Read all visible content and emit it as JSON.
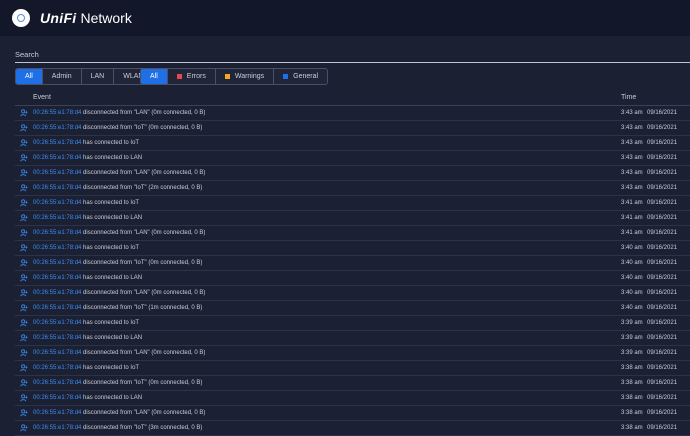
{
  "brand": {
    "name_part1": "UniFi",
    "name_part2": "Network"
  },
  "search": {
    "placeholder": "Search"
  },
  "filters_admin": [
    {
      "label": "All",
      "active": true
    },
    {
      "label": "Admin",
      "active": false
    },
    {
      "label": "LAN",
      "active": false
    },
    {
      "label": "WLAN",
      "active": false
    }
  ],
  "filters_level": [
    {
      "label": "All",
      "active": true,
      "color": ""
    },
    {
      "label": "Errors",
      "active": false,
      "color": "#e5484d"
    },
    {
      "label": "Warnings",
      "active": false,
      "color": "#f5a623"
    },
    {
      "label": "General",
      "active": false,
      "color": "#1f6fe6"
    }
  ],
  "table": {
    "col_event": "Event",
    "col_time": "Time",
    "rows": [
      {
        "mac": "00:26:55:e1:78:d4",
        "text": " disconnected from \"LAN\" (0m connected, 0 B)",
        "time": "3:43 am",
        "date": "09/16/2021"
      },
      {
        "mac": "00:26:55:e1:78:d4",
        "text": " disconnected from \"IoT\" (0m connected, 0 B)",
        "time": "3:43 am",
        "date": "09/16/2021"
      },
      {
        "mac": "00:26:55:e1:78:d4",
        "text": " has connected to IoT",
        "time": "3:43 am",
        "date": "09/16/2021"
      },
      {
        "mac": "00:26:55:e1:78:d4",
        "text": " has connected to LAN",
        "time": "3:43 am",
        "date": "09/16/2021"
      },
      {
        "mac": "00:26:55:e1:78:d4",
        "text": " disconnected from \"LAN\" (0m connected, 0 B)",
        "time": "3:43 am",
        "date": "09/16/2021"
      },
      {
        "mac": "00:26:55:e1:78:d4",
        "text": " disconnected from \"IoT\" (2m connected, 0 B)",
        "time": "3:43 am",
        "date": "09/16/2021"
      },
      {
        "mac": "00:26:55:e1:78:d4",
        "text": " has connected to IoT",
        "time": "3:41 am",
        "date": "09/16/2021"
      },
      {
        "mac": "00:26:55:e1:78:d4",
        "text": " has connected to LAN",
        "time": "3:41 am",
        "date": "09/16/2021"
      },
      {
        "mac": "00:26:55:e1:78:d4",
        "text": " disconnected from \"LAN\" (0m connected, 0 B)",
        "time": "3:41 am",
        "date": "09/16/2021"
      },
      {
        "mac": "00:26:55:e1:78:d4",
        "text": " has connected to IoT",
        "time": "3:40 am",
        "date": "09/16/2021"
      },
      {
        "mac": "00:26:55:e1:78:d4",
        "text": " disconnected from \"IoT\" (0m connected, 0 B)",
        "time": "3:40 am",
        "date": "09/16/2021"
      },
      {
        "mac": "00:26:55:e1:78:d4",
        "text": " has connected to LAN",
        "time": "3:40 am",
        "date": "09/16/2021"
      },
      {
        "mac": "00:26:55:e1:78:d4",
        "text": " disconnected from \"LAN\" (0m connected, 0 B)",
        "time": "3:40 am",
        "date": "09/16/2021"
      },
      {
        "mac": "00:26:55:e1:78:d4",
        "text": " disconnected from \"IoT\" (1m connected, 0 B)",
        "time": "3:40 am",
        "date": "09/16/2021"
      },
      {
        "mac": "00:26:55:e1:78:d4",
        "text": " has connected to IoT",
        "time": "3:39 am",
        "date": "09/16/2021"
      },
      {
        "mac": "00:26:55:e1:78:d4",
        "text": " has connected to LAN",
        "time": "3:39 am",
        "date": "09/16/2021"
      },
      {
        "mac": "00:26:55:e1:78:d4",
        "text": " disconnected from \"LAN\" (0m connected, 0 B)",
        "time": "3:39 am",
        "date": "09/16/2021"
      },
      {
        "mac": "00:26:55:e1:78:d4",
        "text": " has connected to IoT",
        "time": "3:38 am",
        "date": "09/16/2021"
      },
      {
        "mac": "00:26:55:e1:78:d4",
        "text": " disconnected from \"IoT\" (0m connected, 0 B)",
        "time": "3:38 am",
        "date": "09/16/2021"
      },
      {
        "mac": "00:26:55:e1:78:d4",
        "text": " has connected to LAN",
        "time": "3:38 am",
        "date": "09/16/2021"
      },
      {
        "mac": "00:26:55:e1:78:d4",
        "text": " disconnected from \"LAN\" (0m connected, 0 B)",
        "time": "3:38 am",
        "date": "09/16/2021"
      },
      {
        "mac": "00:26:55:e1:78:d4",
        "text": " disconnected from \"IoT\" (3m connected, 0 B)",
        "time": "3:38 am",
        "date": "09/16/2021"
      }
    ]
  }
}
